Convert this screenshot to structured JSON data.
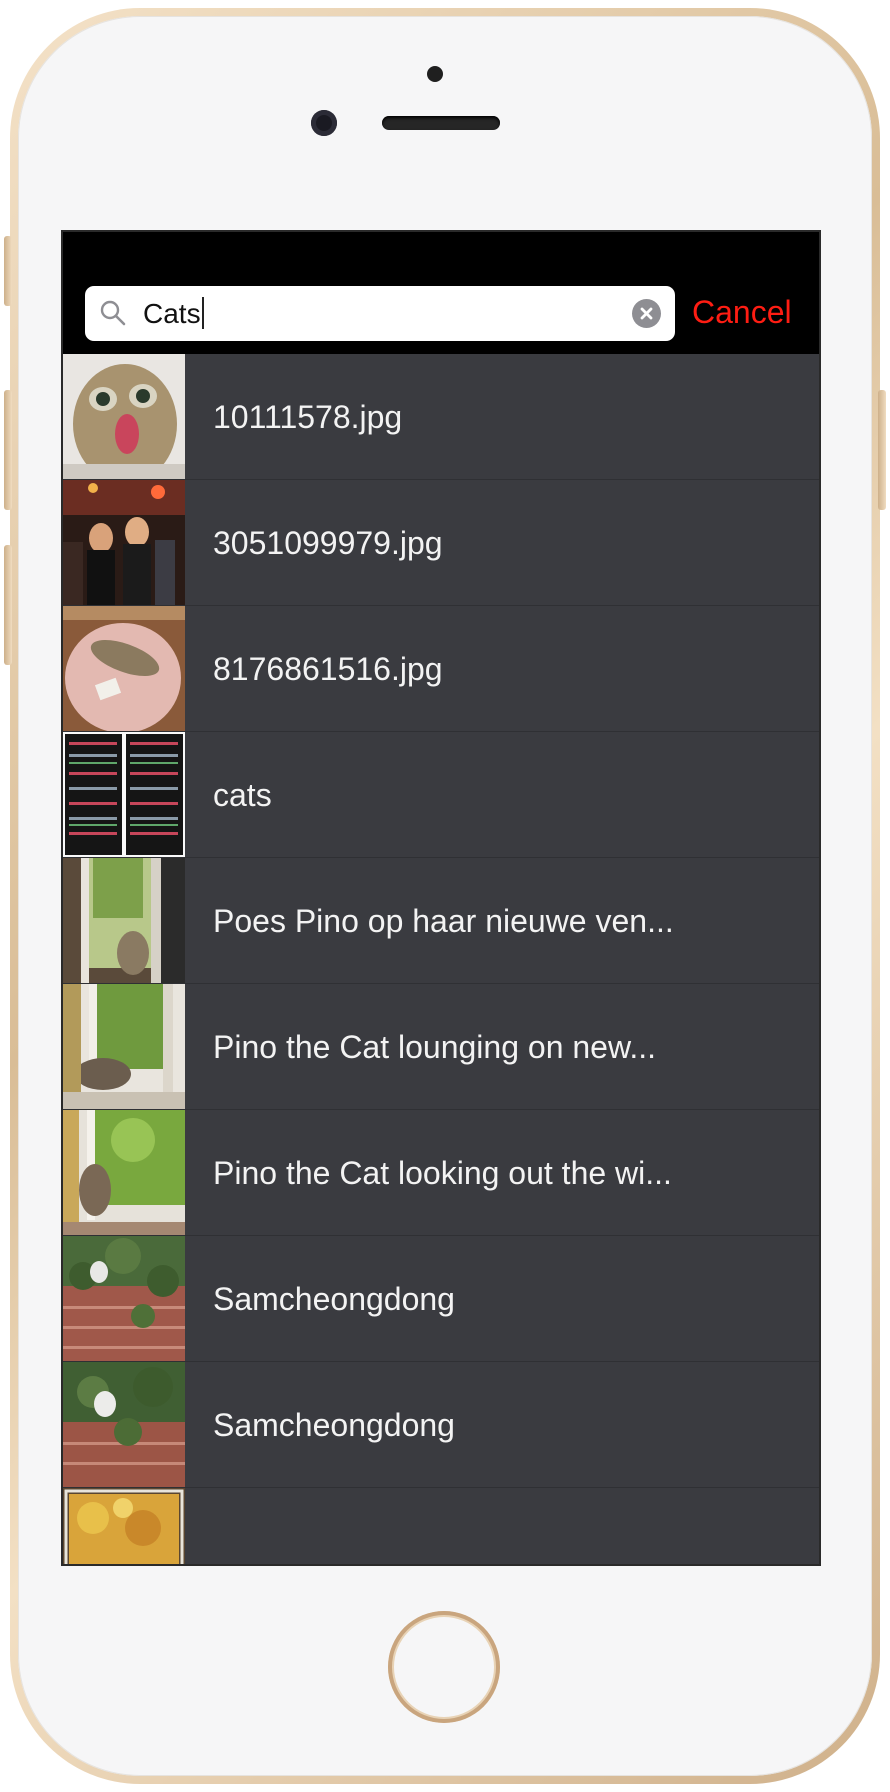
{
  "search": {
    "query": "Cats",
    "cancel_label": "Cancel"
  },
  "results": [
    {
      "label": "10111578.jpg",
      "thumb": "cat-tongue-photo"
    },
    {
      "label": "3051099979.jpg",
      "thumb": "party-people-photo"
    },
    {
      "label": "8176861516.jpg",
      "thumb": "cat-on-table-photo"
    },
    {
      "label": "cats",
      "thumb": "folder-collage-photo"
    },
    {
      "label": "Poes Pino op haar nieuwe ven...",
      "thumb": "cat-window-photo"
    },
    {
      "label": "Pino the Cat lounging on new...",
      "thumb": "cat-window-sill-photo"
    },
    {
      "label": "Pino the Cat looking out the wi...",
      "thumb": "cat-window-green-photo"
    },
    {
      "label": "Samcheongdong",
      "thumb": "cat-ivy-wall-photo"
    },
    {
      "label": "Samcheongdong",
      "thumb": "cat-ivy-wall-photo-2"
    }
  ],
  "colors": {
    "accent": "#fe1d13",
    "list_background": "#3a3b40",
    "screen_header": "#000000"
  }
}
